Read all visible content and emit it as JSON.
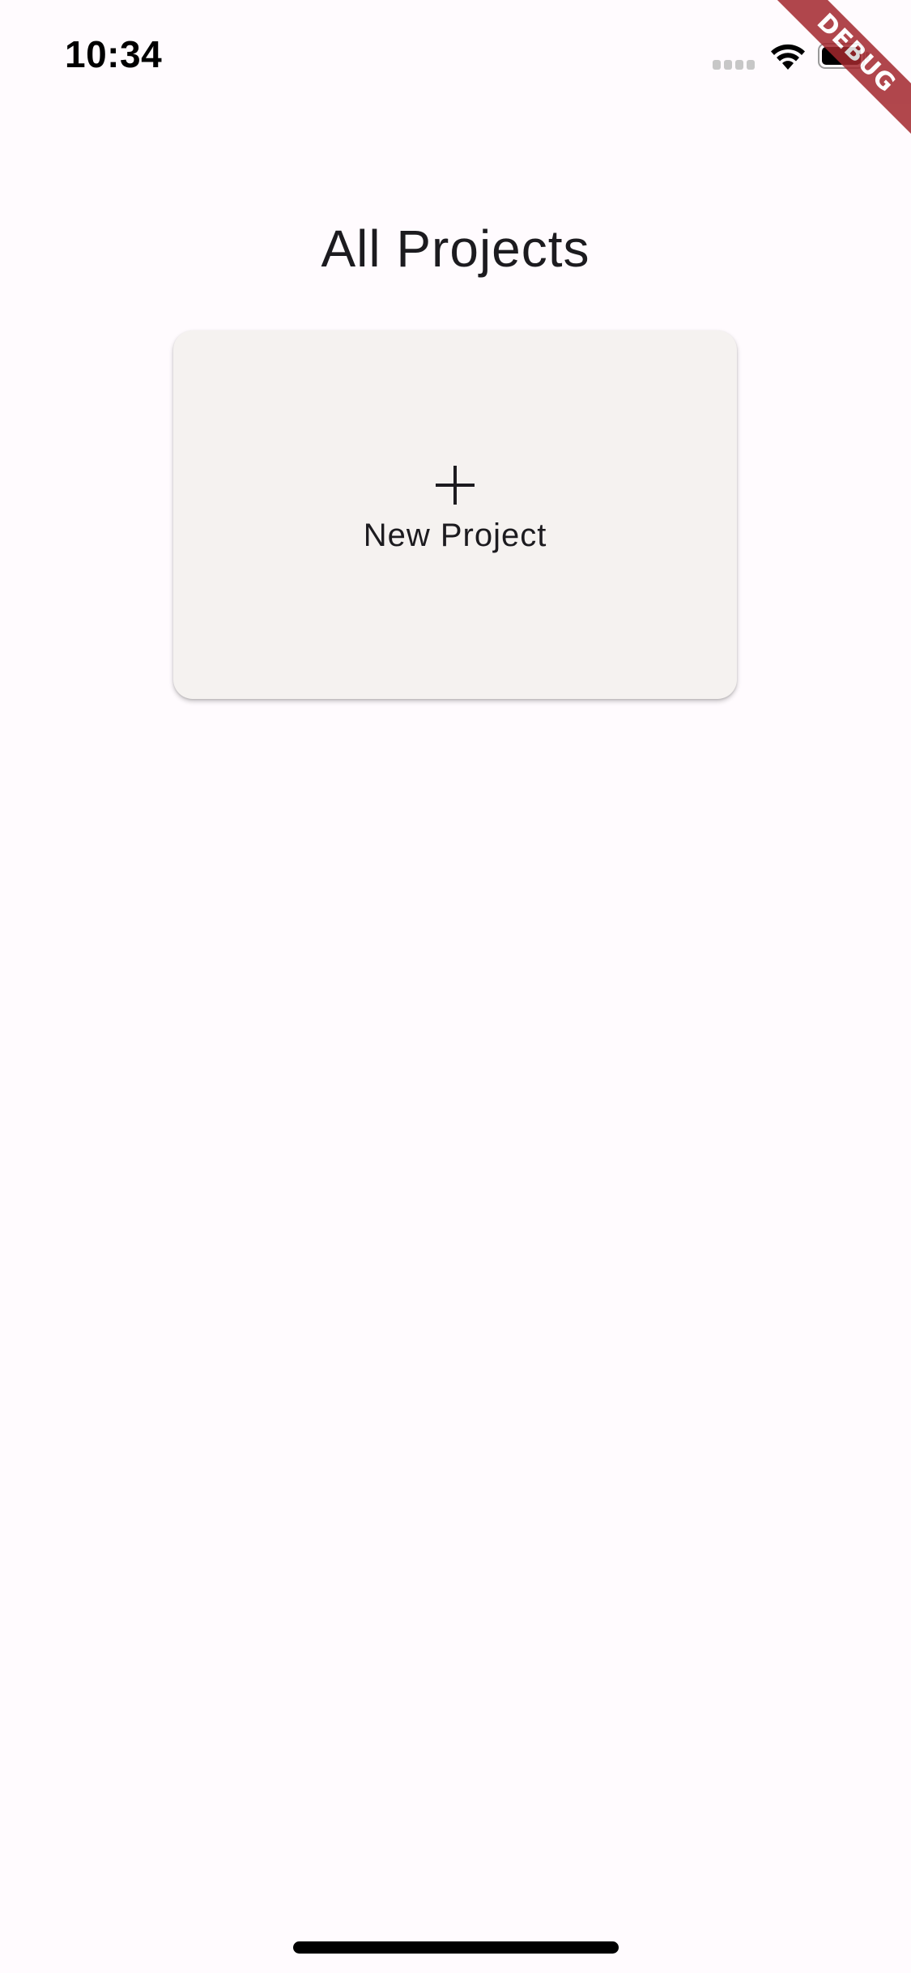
{
  "status_bar": {
    "time": "10:34"
  },
  "debug_banner": {
    "label": "DEBUG"
  },
  "page": {
    "title": "All Projects"
  },
  "new_project_card": {
    "label": "New Project",
    "icon": "plus-icon"
  },
  "colors": {
    "background": "#fffbfe",
    "card": "#f5f2f0",
    "debug_ribbon": "#a3272d",
    "text": "#1c1b1f"
  }
}
